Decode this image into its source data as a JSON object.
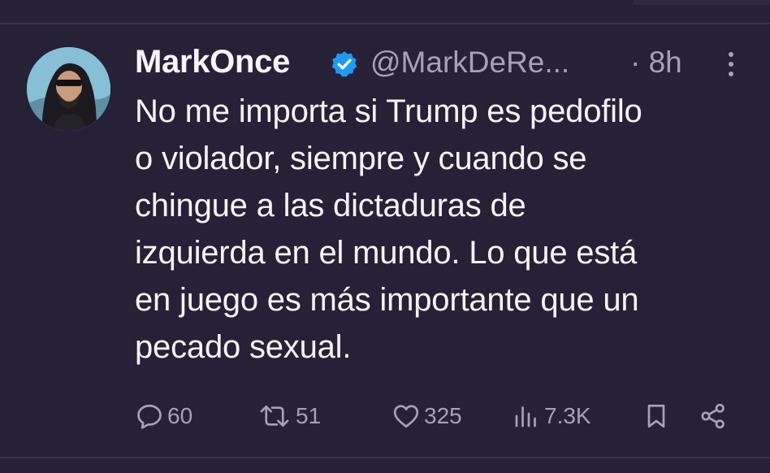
{
  "tweet": {
    "display_name": "MarkOnce",
    "handle": "@MarkDeRe...",
    "time": "· 8h",
    "text": "No me importa si Trump es pedofilo\no violador, siempre y cuando se\nchingue a las dictaduras de\nizquierda en el mundo. Lo que está\nen juego es más importante que un\npecado sexual."
  },
  "actions": {
    "replies": "60",
    "retweets": "51",
    "likes": "325",
    "views": "7.3K"
  },
  "colors": {
    "background": "#262137",
    "text": "#f5f3f8",
    "secondary_text": "#a7a0b6",
    "verified_badge": "#1d9bf0"
  },
  "icons": {
    "verified": "verified-badge-icon",
    "more": "more-vertical-icon",
    "reply": "reply-bubble-icon",
    "retweet": "retweet-icon",
    "like": "heart-icon",
    "views": "views-bar-chart-icon",
    "bookmark": "bookmark-icon",
    "share": "share-icon"
  }
}
